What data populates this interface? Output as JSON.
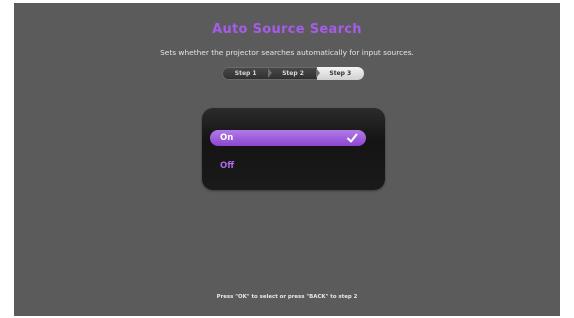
{
  "header": {
    "title": "Auto Source Search",
    "description": "Sets whether the projector searches automatically for input sources."
  },
  "steps": {
    "items": [
      "Step 1",
      "Step 2",
      "Step 3"
    ],
    "active": "Step 3"
  },
  "options": {
    "on_label": "On",
    "off_label": "Off",
    "selected": "On"
  },
  "footer": {
    "hint": "Press \"OK\" to select or press \"BACK\" to step 2"
  },
  "colors": {
    "accent": "#a65ce8",
    "background": "#5b5b5b",
    "panel": "#1a1a1a"
  },
  "icons": {
    "check": "check-icon"
  }
}
